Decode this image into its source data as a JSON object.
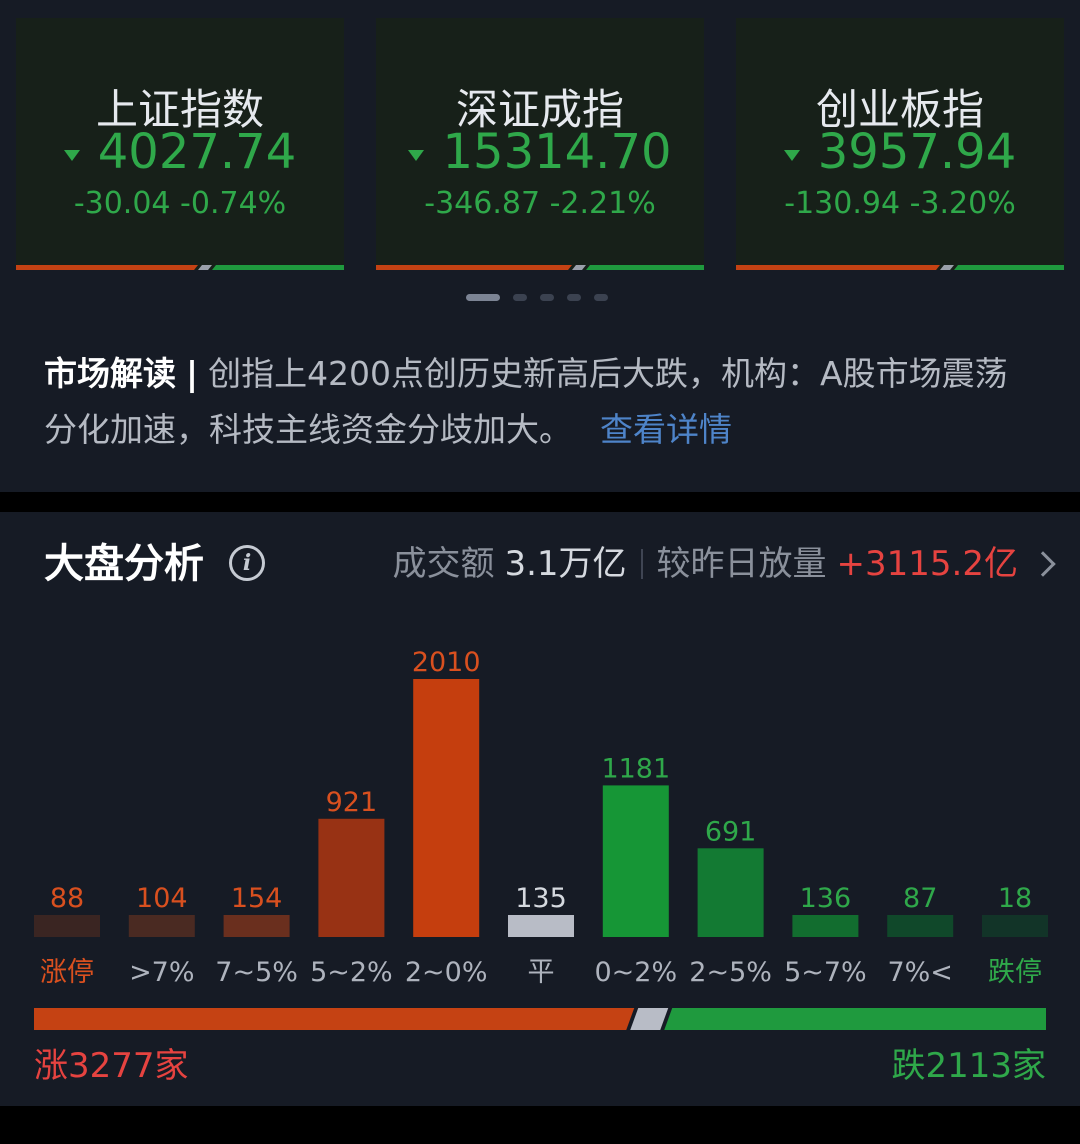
{
  "indices": [
    {
      "name": "上证指数",
      "value": "4027.74",
      "change": "-30.04 -0.74%"
    },
    {
      "name": "深证成指",
      "value": "15314.70",
      "change": "-346.87 -2.21%"
    },
    {
      "name": "创业板指",
      "value": "3957.94",
      "change": "-130.94 -3.20%"
    }
  ],
  "carousel": {
    "total": 5,
    "active": 1
  },
  "commentary": {
    "title": "市场解读",
    "separator": "|",
    "text": "创指上4200点创历史新高后大跌，机构：A股市场震荡分化加速，科技主线资金分歧加大。",
    "link": "查看详情"
  },
  "analysis": {
    "title": "大盘分析",
    "info_icon": "i",
    "turnover_label": "成交额",
    "turnover_value": "3.1万亿",
    "compare_label": "较昨日放量",
    "compare_value": "+3115.2亿"
  },
  "colors": {
    "up": "#e64340",
    "down": "#2fa84a",
    "flat": "#b8bcc6",
    "accent_link": "#4e84c9"
  },
  "chart_data": {
    "type": "bar",
    "categories": [
      "涨停",
      ">7%",
      "7~5%",
      "5~2%",
      "2~0%",
      "平",
      "0~2%",
      "2~5%",
      "5~7%",
      "7%<",
      "跌停"
    ],
    "values": [
      88,
      104,
      154,
      921,
      2010,
      135,
      1181,
      691,
      136,
      87,
      18
    ],
    "bar_colors": [
      "#3a2522",
      "#4a2a22",
      "#6a2f1e",
      "#983214",
      "#c53e0e",
      "#b8bcc6",
      "#169636",
      "#137a33",
      "#126d2f",
      "#10482a",
      "#123428"
    ],
    "label_colors": [
      "#d9501f",
      "#aeb3bd",
      "#aeb3bd",
      "#aeb3bd",
      "#aeb3bd",
      "#aeb3bd",
      "#aeb3bd",
      "#aeb3bd",
      "#aeb3bd",
      "#aeb3bd",
      "#2fa84a"
    ],
    "value_colors": [
      "#d9501f",
      "#d9501f",
      "#d9501f",
      "#d9501f",
      "#d9501f",
      "#d5d9df",
      "#2fa84a",
      "#2fa84a",
      "#2fa84a",
      "#2fa84a",
      "#2fa84a"
    ]
  },
  "breadth": {
    "up_label": "涨3277家",
    "down_label": "跌2113家",
    "up": 3277,
    "flat": 135,
    "down": 2113
  }
}
